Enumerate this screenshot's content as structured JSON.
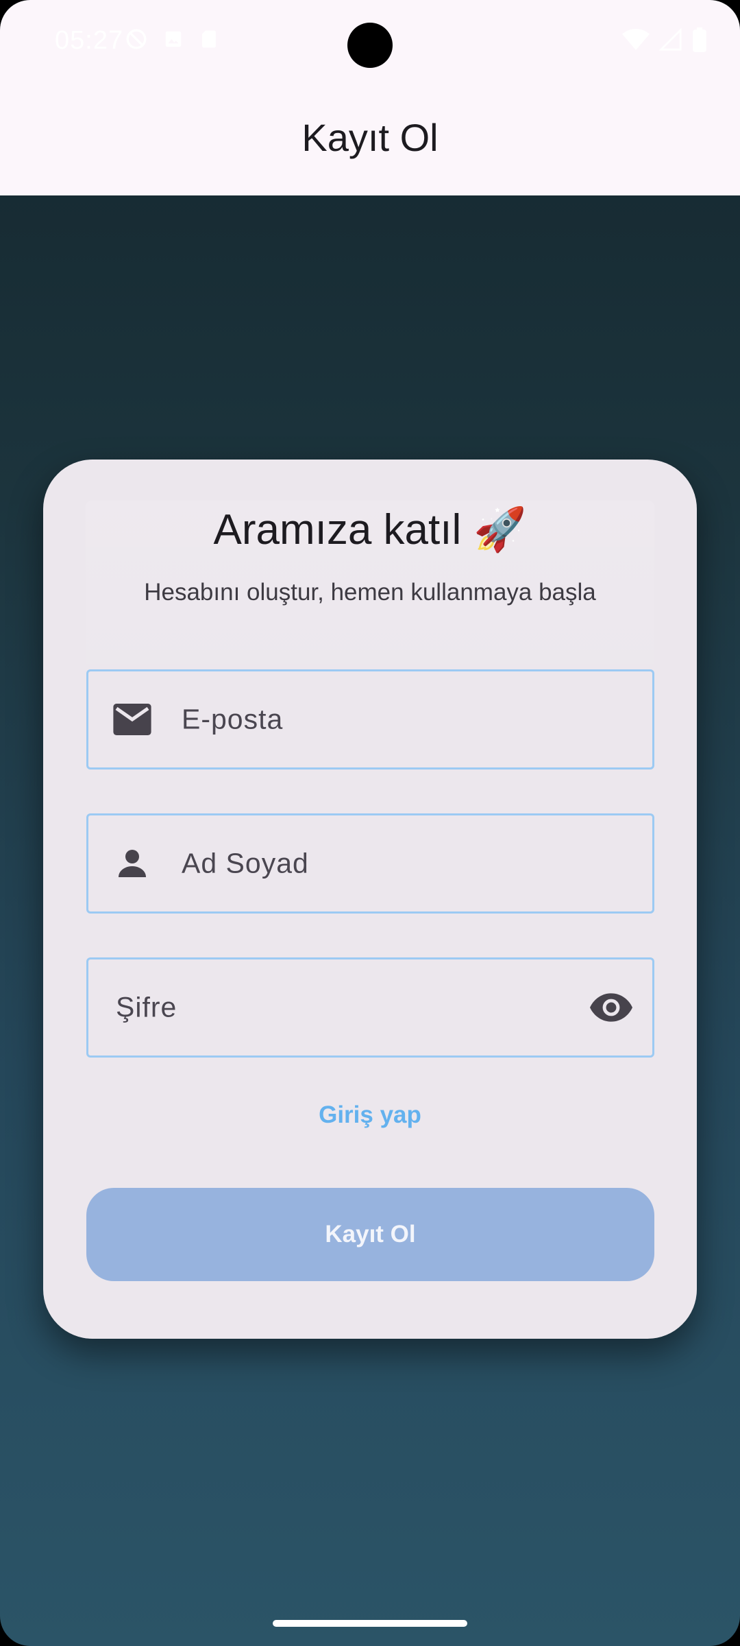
{
  "status_bar": {
    "time": "05:27",
    "left_icons": [
      "do-not-disturb-icon",
      "image-icon",
      "sd-card-icon"
    ],
    "right_icons": [
      "wifi-icon",
      "signal-icon",
      "battery-icon"
    ]
  },
  "app_bar": {
    "title": "Kayıt Ol"
  },
  "card": {
    "heading": "Aramıza katıl",
    "heading_emoji": "🚀",
    "subheading": "Hesabını oluştur, hemen kullanmaya başla",
    "fields": {
      "email": {
        "placeholder": "E-posta",
        "icon": "mail-icon"
      },
      "name": {
        "placeholder": "Ad Soyad",
        "icon": "person-icon"
      },
      "password": {
        "placeholder": "Şifre",
        "trailing_icon": "eye-icon"
      }
    },
    "login_link": "Giriş yap",
    "submit_label": "Kayıt Ol"
  },
  "colors": {
    "field_border": "#9ccaf3",
    "link": "#63b1ee",
    "button_disabled": "#97b3de",
    "card_bg": "#ece7ed",
    "app_bar_bg": "#fcf6fb"
  }
}
